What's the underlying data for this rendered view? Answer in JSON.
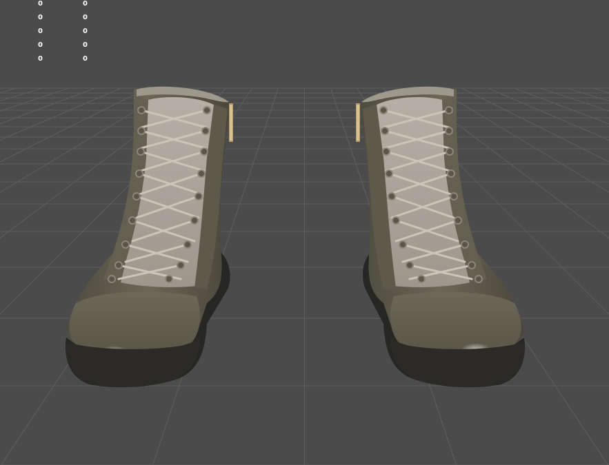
{
  "stats": {
    "rows": [
      {
        "a": "0",
        "b": "0"
      },
      {
        "a": "0",
        "b": "0"
      },
      {
        "a": "0",
        "b": "0"
      },
      {
        "a": "0",
        "b": "0"
      },
      {
        "a": "0",
        "b": "0"
      }
    ]
  },
  "scene": {
    "objects": [
      {
        "name": "left-boot"
      },
      {
        "name": "right-boot"
      }
    ]
  },
  "colors": {
    "background": "#4b4b4b",
    "grid_line": "#5f5f5f",
    "boot_leather": "#5e5a4c",
    "boot_light": "#8a8472",
    "boot_mesh": "#a9a59b",
    "sole": "#262624",
    "zipper": "#b39a6a"
  }
}
